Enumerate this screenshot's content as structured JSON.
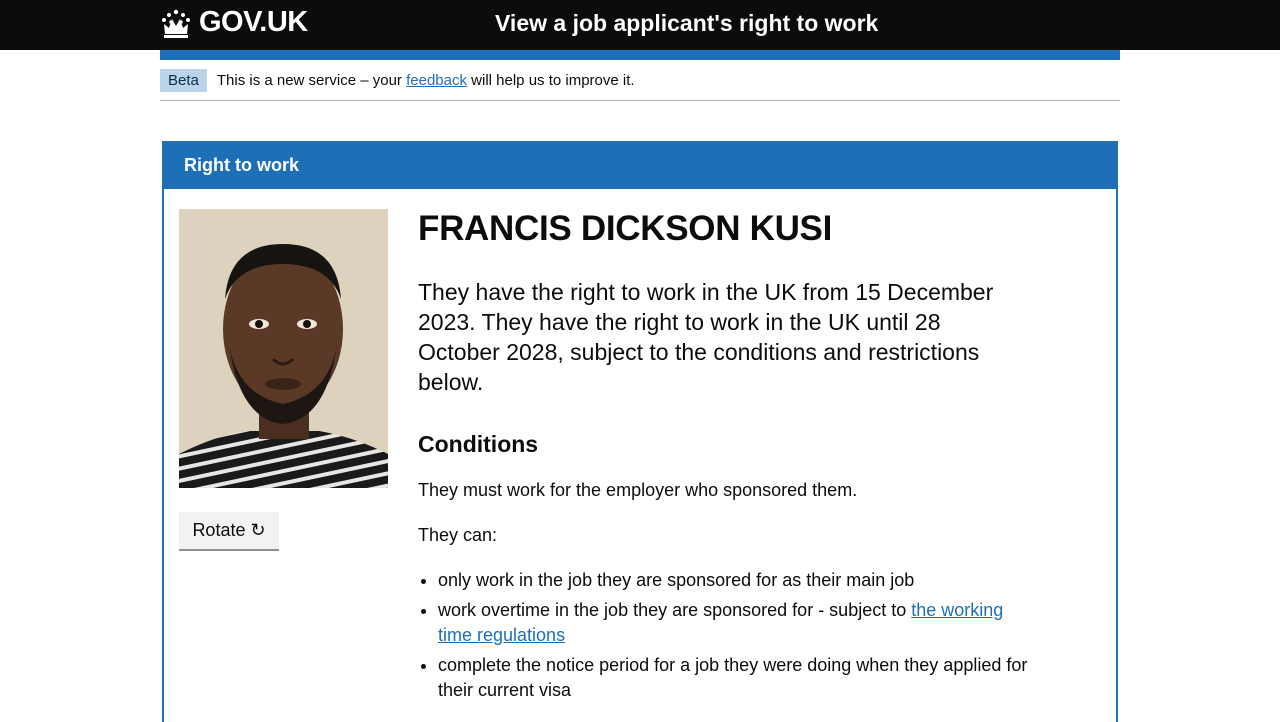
{
  "header": {
    "logo_text": "GOV.UK",
    "service_name": "View a job applicant's right to work"
  },
  "phase_banner": {
    "tag": "Beta",
    "text_before": "This is a new service – your",
    "link": "feedback",
    "text_after": "will help us to improve it."
  },
  "panel": {
    "title": "Right to work",
    "rotate_label": "Rotate ↻",
    "name": "FRANCIS DICKSON KUSI",
    "status": "They have the right to work in the UK from 15 December 2023. They have the right to work in the UK until 28 October 2028, subject to the conditions and restrictions below.",
    "conditions_heading": "Conditions",
    "sponsor_text": "They must work for the employer who sponsored them.",
    "they_can": "They can:",
    "items": [
      {
        "text": "only work in the job they are sponsored for as their main job"
      },
      {
        "text": "work overtime in the job they are sponsored for - subject to",
        "link": "the working time regulations"
      },
      {
        "text": "complete the notice period for a job they were doing when they applied for their current visa"
      }
    ]
  },
  "colors": {
    "header_bg": "#0b0c0c",
    "brand_blue": "#1d70b8",
    "beta_tag_bg": "#bbd4ea"
  },
  "icons": [
    "crown-icon",
    "rotate-icon"
  ]
}
